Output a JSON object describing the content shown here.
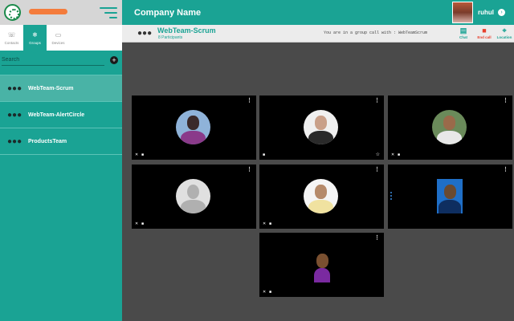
{
  "header": {
    "company_name": "Company Name",
    "user_name": "ruhul"
  },
  "sidebar": {
    "tabs": [
      {
        "label": "Contacts",
        "icon": "contacts-icon",
        "active": false
      },
      {
        "label": "Groups",
        "icon": "groups-icon",
        "active": true
      },
      {
        "label": "Devices",
        "icon": "devices-icon",
        "active": false
      }
    ],
    "search_placeholder": "Search",
    "groups": [
      {
        "label": "WebTeam-Scrum",
        "active": true
      },
      {
        "label": "WebTeam-AlertCircle",
        "active": false
      },
      {
        "label": "ProductsTeam",
        "active": false
      }
    ]
  },
  "call": {
    "room_name": "WebTeam-Scrum",
    "participants": "8 Participants",
    "call_with_text": "You are in a group call with : WebTeamScrum",
    "actions": [
      {
        "label": "Chat",
        "icon": "chat-icon"
      },
      {
        "label": "End call",
        "icon": "end-call-icon"
      },
      {
        "label": "Location",
        "icon": "location-pin-icon"
      }
    ]
  },
  "colors": {
    "primary": "#1aa394",
    "end_call": "#e8402c",
    "accent_bar": "#f47c3c",
    "stage": "#4a4a4a"
  }
}
